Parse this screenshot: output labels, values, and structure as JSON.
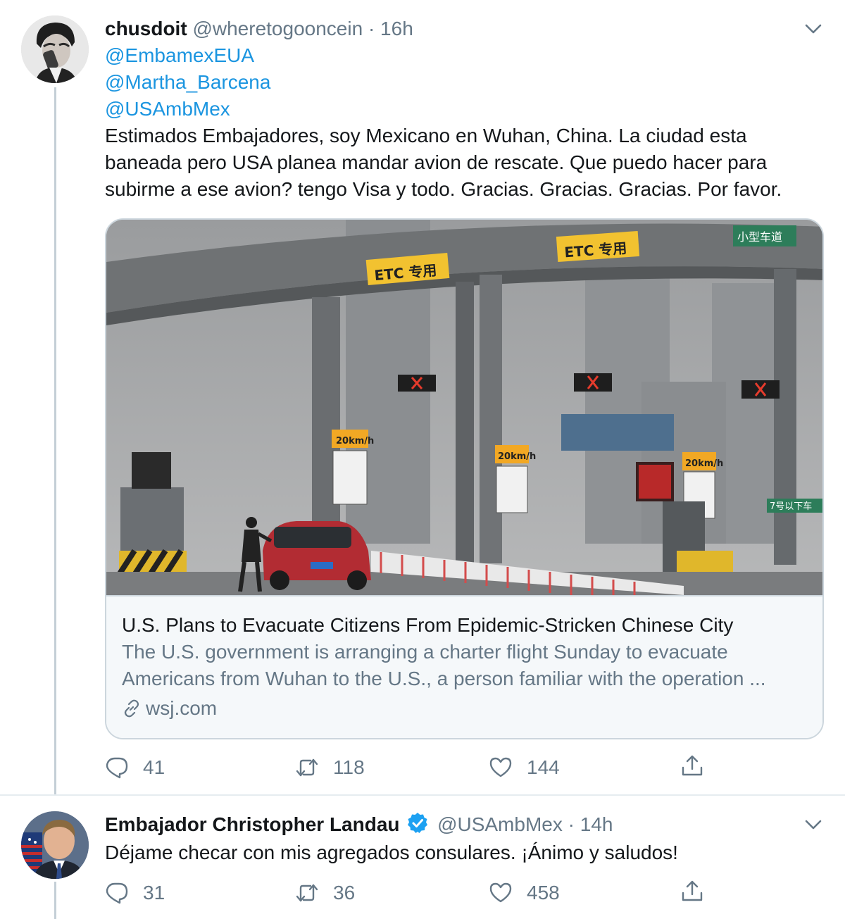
{
  "tweets": [
    {
      "name": "chusdoit",
      "handle": "@wheretogooncein",
      "separator": "·",
      "time": "16h",
      "mentions": [
        "@EmbamexEUA",
        "@Martha_Barcena",
        "@USAmbMex"
      ],
      "text": "Estimados Embajadores, soy Mexicano en Wuhan, China. La ciudad esta baneada pero USA planea mandar avion de rescate. Que puedo hacer para subirme a ese avion? tengo Visa y todo. Gracias. Gracias. Gracias. Por favor.",
      "card": {
        "sign_left": "ETC 专用",
        "sign_mid": "ETC 专用",
        "sign_right": "小型车道",
        "speed_1": "20km/h",
        "speed_2": "20km/h",
        "speed_3": "20km/h",
        "lane_sign": "7号以下车",
        "title": "U.S. Plans to Evacuate Citizens From Epidemic-Stricken Chinese City",
        "description": "The U.S. government is arranging a charter flight Sunday to evacuate Americans from Wuhan to the U.S., a person familiar with the operation ...",
        "domain": "wsj.com"
      },
      "replies": "41",
      "retweets": "118",
      "likes": "144"
    },
    {
      "name": "Embajador Christopher Landau",
      "verified": true,
      "handle": "@USAmbMex",
      "separator": "·",
      "time": "14h",
      "text": "Déjame checar con mis agregados consulares. ¡Ánimo y saludos!",
      "replies": "31",
      "retweets": "36",
      "likes": "458"
    }
  ],
  "icons": {
    "reply": "reply-icon",
    "retweet": "retweet-icon",
    "like": "heart-icon",
    "share": "share-icon",
    "caret": "chevron-down-icon",
    "link": "link-icon",
    "verified": "verified-badge-icon"
  },
  "colors": {
    "link_blue": "#1b95e0",
    "muted_gray": "#657786",
    "verified_blue": "#1da1f2",
    "thread_line": "#c4cfd6"
  }
}
